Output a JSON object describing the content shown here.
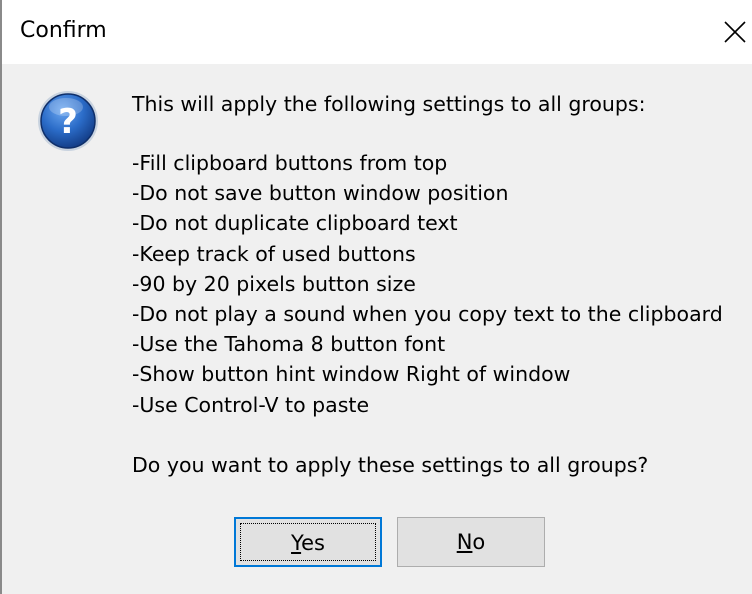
{
  "window": {
    "title": "Confirm",
    "close_icon": "close-icon"
  },
  "message": {
    "icon": "question-icon",
    "intro": "This will apply the following settings to all groups:",
    "settings": [
      "-Fill clipboard buttons from top",
      "-Do not save button window position",
      "-Do not duplicate clipboard text",
      "-Keep track of used buttons",
      "-90 by 20 pixels button size",
      "-Do not play a sound when you copy text to the clipboard",
      "-Use the Tahoma 8 button font",
      "-Show button hint window Right of window",
      "-Use Control-V to paste"
    ],
    "question": "Do you want to apply these settings to all groups?"
  },
  "buttons": {
    "yes": {
      "mnemonic": "Y",
      "rest": "es"
    },
    "no": {
      "mnemonic": "N",
      "rest": "o"
    }
  },
  "colors": {
    "dialog_bg": "#f0f0f0",
    "titlebar_bg": "#ffffff",
    "button_bg": "#e1e1e1",
    "focus_border": "#0078d7",
    "icon_blue": "#1f5fb8"
  }
}
